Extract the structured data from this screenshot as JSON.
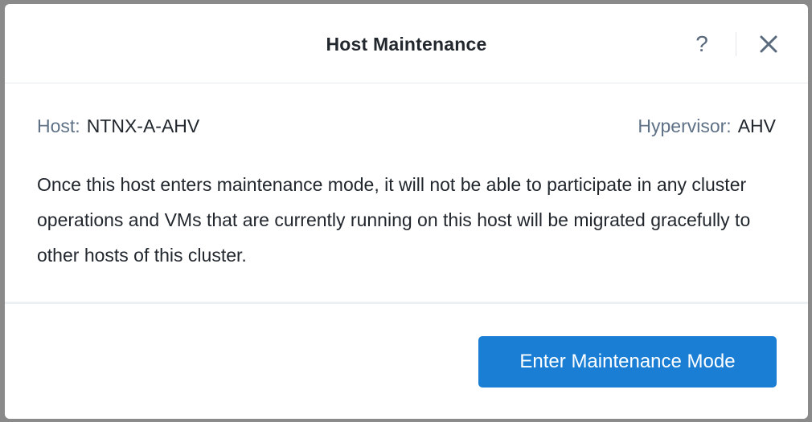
{
  "dialog": {
    "title": "Host Maintenance",
    "help_glyph": "?",
    "close_icon": "close-icon"
  },
  "info": {
    "host_label": "Host:",
    "host_value": "NTNX-A-AHV",
    "hypervisor_label": "Hypervisor:",
    "hypervisor_value": "AHV"
  },
  "description": "Once this host enters maintenance mode, it will not be able to participate in any cluster operations and VMs that are currently running on this host will be migrated gracefully to other hosts of this cluster.",
  "footer": {
    "primary_button_label": "Enter Maintenance Mode"
  },
  "colors": {
    "primary": "#1a7fd4",
    "label": "#5f7186",
    "text": "#22272e",
    "icon": "#5a6a7c"
  }
}
